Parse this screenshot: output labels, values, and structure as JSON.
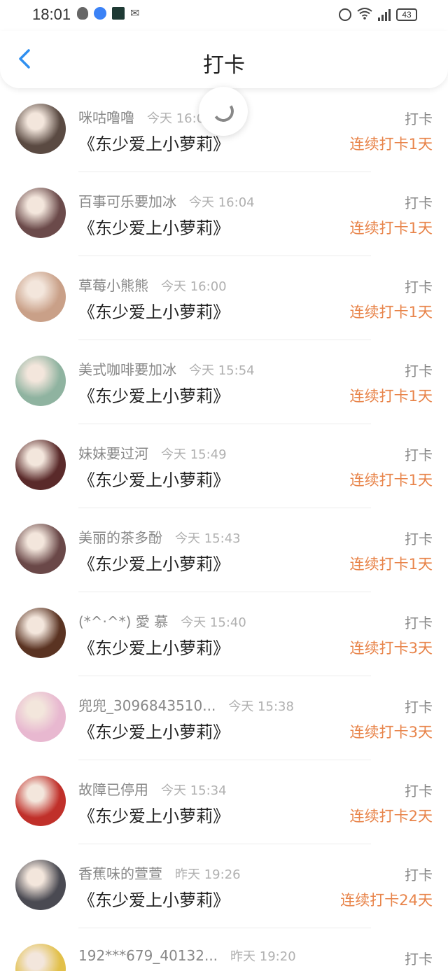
{
  "status_bar": {
    "time": "18:01",
    "battery": "43"
  },
  "header": {
    "title": "打卡"
  },
  "rows": [
    {
      "user": "咪咕噜噜",
      "time": "今天 16:0",
      "book": "《东少爱上小萝莉》",
      "action": "打卡",
      "streak": "连续打卡1天",
      "avatar_color": "#5a4a42"
    },
    {
      "user": "百事可乐要加冰",
      "time": "今天 16:04",
      "book": "《东少爱上小萝莉》",
      "action": "打卡",
      "streak": "连续打卡1天",
      "avatar_color": "#6b4a4a"
    },
    {
      "user": "草莓小熊熊",
      "time": "今天 16:00",
      "book": "《东少爱上小萝莉》",
      "action": "打卡",
      "streak": "连续打卡1天",
      "avatar_color": "#c9a088"
    },
    {
      "user": "美式咖啡要加冰",
      "time": "今天 15:54",
      "book": "《东少爱上小萝莉》",
      "action": "打卡",
      "streak": "连续打卡1天",
      "avatar_color": "#8fb3a0"
    },
    {
      "user": "妹妹要过河",
      "time": "今天 15:49",
      "book": "《东少爱上小萝莉》",
      "action": "打卡",
      "streak": "连续打卡1天",
      "avatar_color": "#5a2a2a"
    },
    {
      "user": "美丽的茶多酚",
      "time": "今天 15:43",
      "book": "《东少爱上小萝莉》",
      "action": "打卡",
      "streak": "连续打卡1天",
      "avatar_color": "#6a4848"
    },
    {
      "user": "(*^·^*) 愛 慕",
      "time": "今天 15:40",
      "book": "《东少爱上小萝莉》",
      "action": "打卡",
      "streak": "连续打卡3天",
      "avatar_color": "#5a3322"
    },
    {
      "user": "兜兜_3096843510...",
      "time": "今天 15:38",
      "book": "《东少爱上小萝莉》",
      "action": "打卡",
      "streak": "连续打卡3天",
      "avatar_color": "#e8b8d0"
    },
    {
      "user": "故障已停用",
      "time": "今天 15:34",
      "book": "《东少爱上小萝莉》",
      "action": "打卡",
      "streak": "连续打卡2天",
      "avatar_color": "#c0302a"
    },
    {
      "user": "香蕉味的萱萱",
      "time": "昨天 19:26",
      "book": "《东少爱上小萝莉》",
      "action": "打卡",
      "streak": "连续打卡24天",
      "avatar_color": "#4a4a52"
    },
    {
      "user": "192***679_40132...",
      "time": "昨天 19:20",
      "book": "",
      "action": "打卡",
      "streak": "",
      "avatar_color": "#e2c04a"
    }
  ],
  "colors": {
    "accent_blue": "#2f8ff0",
    "streak_orange": "#e8844a"
  }
}
